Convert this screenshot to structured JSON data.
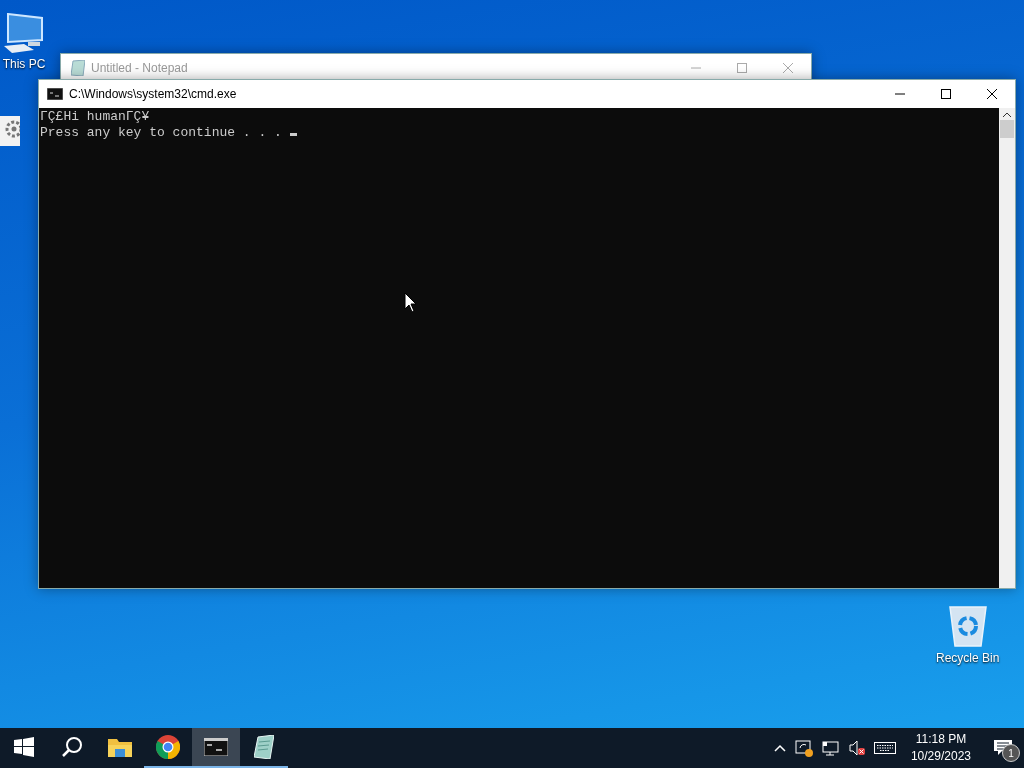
{
  "desktop_icons": [
    {
      "kind": "computer",
      "label": "This PC"
    },
    {
      "kind": "settings"
    },
    {
      "kind": "recycle",
      "label": "Recycle Bin"
    }
  ],
  "windows": [
    {
      "kind": "notepad",
      "title": "Untitled - Notepad",
      "active": false
    },
    {
      "kind": "console",
      "title": "C:\\Windows\\system32\\cmd.exe",
      "active": true,
      "lines": [
        "ΓÇ£Hi humanΓÇ¥",
        "Press any key to continue . . . "
      ]
    }
  ],
  "taskbar": {
    "apps": [
      {
        "kind": "start",
        "running": false,
        "selected": false
      },
      {
        "kind": "search",
        "running": false,
        "selected": false
      },
      {
        "kind": "explorer",
        "running": false,
        "selected": false
      },
      {
        "kind": "chrome",
        "running": true,
        "selected": false
      },
      {
        "kind": "console",
        "running": true,
        "selected": true
      },
      {
        "kind": "notepad",
        "running": true,
        "selected": false
      }
    ],
    "time": "11:18 PM",
    "date": "10/29/2023",
    "notification_count": "1"
  }
}
